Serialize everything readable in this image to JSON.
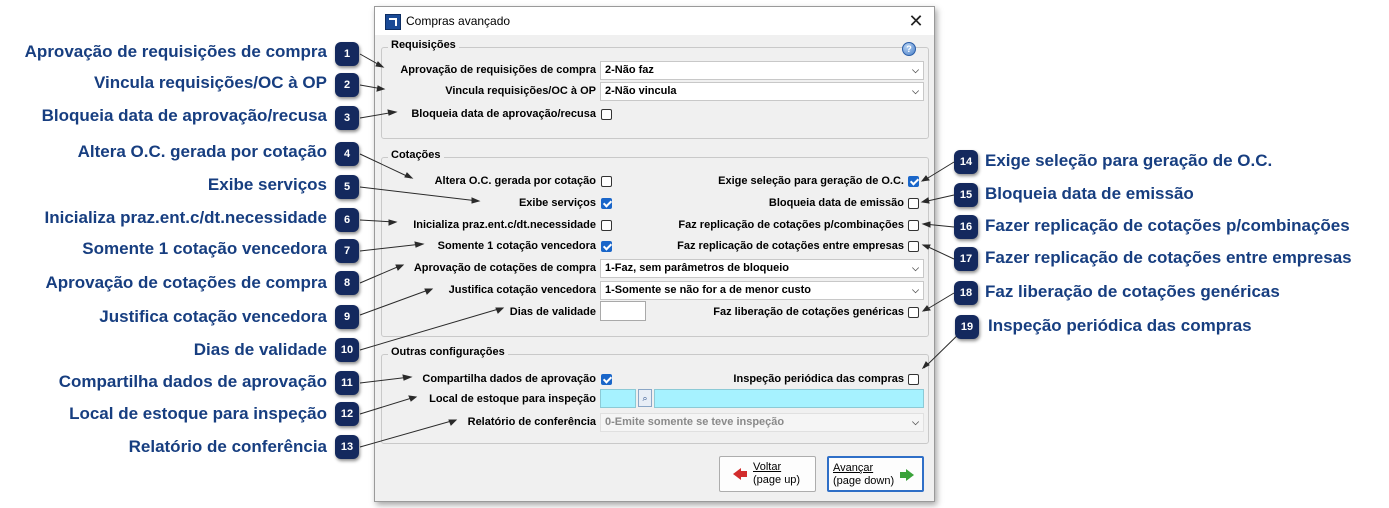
{
  "window": {
    "title": "Compras avançado",
    "close_glyph": "✕",
    "help_glyph": "?"
  },
  "groups": {
    "requisicoes": "Requisições",
    "cotacoes": "Cotações",
    "outras": "Outras configurações"
  },
  "fields": {
    "aprov_req": {
      "label": "Aprovação de requisições de compra",
      "value": "2-Não faz"
    },
    "vincula_req": {
      "label": "Vincula requisições/OC à OP",
      "value": "2-Não vincula"
    },
    "bloqueia_aprov": {
      "label": "Bloqueia data de aprovação/recusa",
      "checked": false
    },
    "altera_oc": {
      "label": "Altera O.C. gerada por cotação",
      "checked": false
    },
    "exibe_servicos": {
      "label": "Exibe serviços",
      "checked": true
    },
    "inicializa_praz": {
      "label": "Inicializa praz.ent.c/dt.necessidade",
      "checked": false
    },
    "somente_1": {
      "label": "Somente 1 cotação vencedora",
      "checked": true
    },
    "aprov_cot": {
      "label": "Aprovação de cotações de compra",
      "value": "1-Faz, sem parâmetros de bloqueio"
    },
    "justifica": {
      "label": "Justifica cotação vencedora",
      "value": "1-Somente se não for a de menor custo"
    },
    "dias_validade": {
      "label": "Dias de validade",
      "value": ""
    },
    "exige_selecao": {
      "label": "Exige seleção para geração de O.C.",
      "checked": true
    },
    "bloqueia_emissao": {
      "label": "Bloqueia data de emissão",
      "checked": false
    },
    "replic_comb": {
      "label": "Faz replicação de cotações p/combinações",
      "checked": false
    },
    "replic_emp": {
      "label": "Faz replicação de cotações entre empresas",
      "checked": false
    },
    "liberacao": {
      "label": "Faz liberação de cotações genéricas",
      "checked": false
    },
    "compartilha": {
      "label": "Compartilha dados de aprovação",
      "checked": true
    },
    "inspecao": {
      "label": "Inspeção periódica das compras",
      "checked": false
    },
    "local_estoque": {
      "label": "Local de estoque para inspeção",
      "code": "",
      "description": ""
    },
    "relatorio": {
      "label": "Relatório de conferência",
      "value": "0-Emite somente se teve inspeção"
    }
  },
  "buttons": {
    "voltar": {
      "line1": "Voltar",
      "line2": "(page up)"
    },
    "avancar": {
      "line1": "Avançar",
      "line2": "(page down)"
    }
  },
  "callouts": [
    {
      "n": "1",
      "text": "Aprovação de requisições de compra"
    },
    {
      "n": "2",
      "text": "Vincula requisições/OC à OP"
    },
    {
      "n": "3",
      "text": "Bloqueia data de aprovação/recusa"
    },
    {
      "n": "4",
      "text": "Altera O.C. gerada por cotação"
    },
    {
      "n": "5",
      "text": "Exibe serviços"
    },
    {
      "n": "6",
      "text": "Inicializa praz.ent.c/dt.necessidade"
    },
    {
      "n": "7",
      "text": "Somente 1 cotação vencedora"
    },
    {
      "n": "8",
      "text": "Aprovação de cotações de compra"
    },
    {
      "n": "9",
      "text": "Justifica cotação vencedora"
    },
    {
      "n": "10",
      "text": "Dias de validade"
    },
    {
      "n": "11",
      "text": "Compartilha dados de aprovação"
    },
    {
      "n": "12",
      "text": "Local de estoque para inspeção"
    },
    {
      "n": "13",
      "text": "Relatório de conferência"
    },
    {
      "n": "14",
      "text": "Exige seleção para geração de O.C."
    },
    {
      "n": "15",
      "text": "Bloqueia data de emissão"
    },
    {
      "n": "16",
      "text": "Fazer replicação de cotações p/combinações"
    },
    {
      "n": "17",
      "text": "Fazer replicação de cotações entre empresas"
    },
    {
      "n": "18",
      "text": "Faz liberação de cotações genéricas"
    },
    {
      "n": "19",
      "text": "Inspeção periódica das compras"
    }
  ],
  "colors": {
    "callout_text": "#173e80",
    "badge_bg": "#14295e",
    "checkbox_on": "#1a66c9",
    "lookup_field": "#a6f2ff"
  }
}
